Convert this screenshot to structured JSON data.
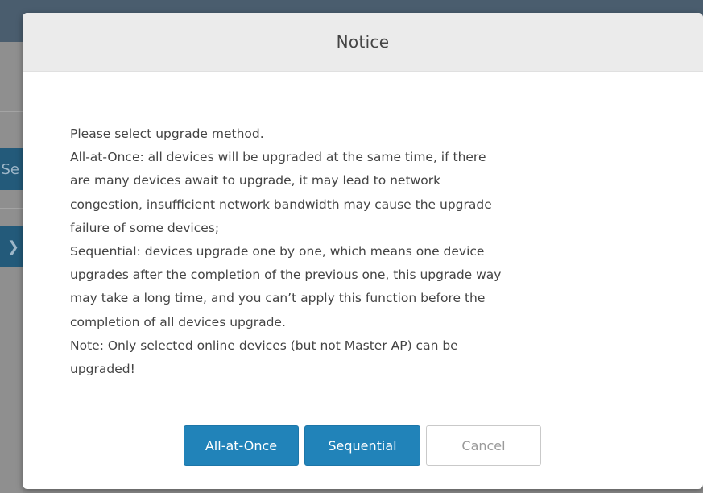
{
  "dialog": {
    "title": "Notice",
    "body": [
      "Please select upgrade method.",
      "All-at-Once: all devices will be upgraded at the same time, if there",
      "are many devices await to upgrade, it may lead to network",
      "congestion, insufficient network bandwidth may cause the upgrade",
      "failure of some devices;",
      "Sequential: devices upgrade one by one, which means one device",
      "upgrades after the completion of the previous one, this upgrade way",
      "may take a long time, and you can’t apply this function before the",
      "completion of all devices upgrade.",
      "Note: Only selected online devices (but not Master AP) can be",
      "upgraded!"
    ],
    "buttons": {
      "all_at_once": "All-at-Once",
      "sequential": "Sequential",
      "cancel": "Cancel"
    }
  },
  "background": {
    "button_1_glyph": "Se",
    "button_2_glyph": "❯"
  },
  "colors": {
    "primary": "#2183b9",
    "header_bg": "#ebebeb",
    "text": "#444444",
    "overlay": "#8b8b8b"
  }
}
